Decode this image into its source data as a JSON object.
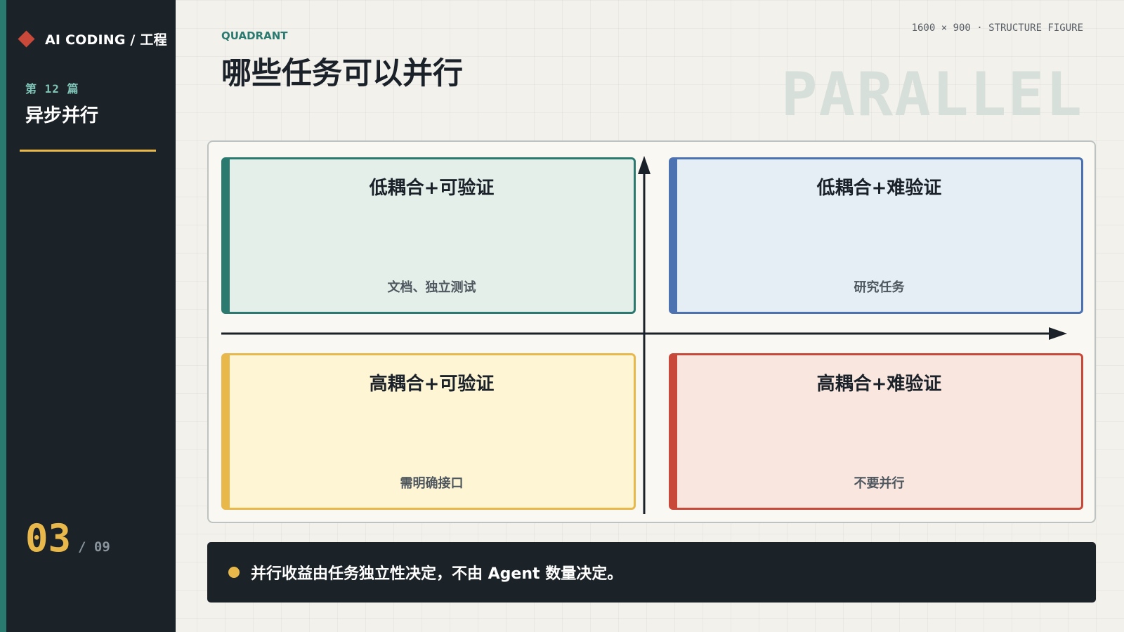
{
  "sidebar": {
    "brand": "AI CODING / 工程",
    "issue_label": "第 12 篇",
    "issue_title": "异步并行",
    "page_current": "03",
    "page_total": "/ 09"
  },
  "header": {
    "eyebrow": "QUADRANT",
    "title": "哪些任务可以并行",
    "meta_caption": "1600 × 900 · STRUCTURE FIGURE",
    "watermark": "PARALLEL"
  },
  "quadrants": {
    "top_left": {
      "title": "低耦合+可验证",
      "note": "文档、独立测试"
    },
    "top_right": {
      "title": "低耦合+难验证",
      "note": "研究任务"
    },
    "bottom_left": {
      "title": "高耦合+可验证",
      "note": "需明确接口"
    },
    "bottom_right": {
      "title": "高耦合+难验证",
      "note": "不要并行"
    }
  },
  "callout": {
    "text": "并行收益由任务独立性决定，不由 Agent 数量决定。"
  },
  "colors": {
    "teal": "#2a7a70",
    "blue": "#4d72b2",
    "gold": "#e8b84a",
    "red": "#c8483a",
    "dark": "#1b2228"
  }
}
